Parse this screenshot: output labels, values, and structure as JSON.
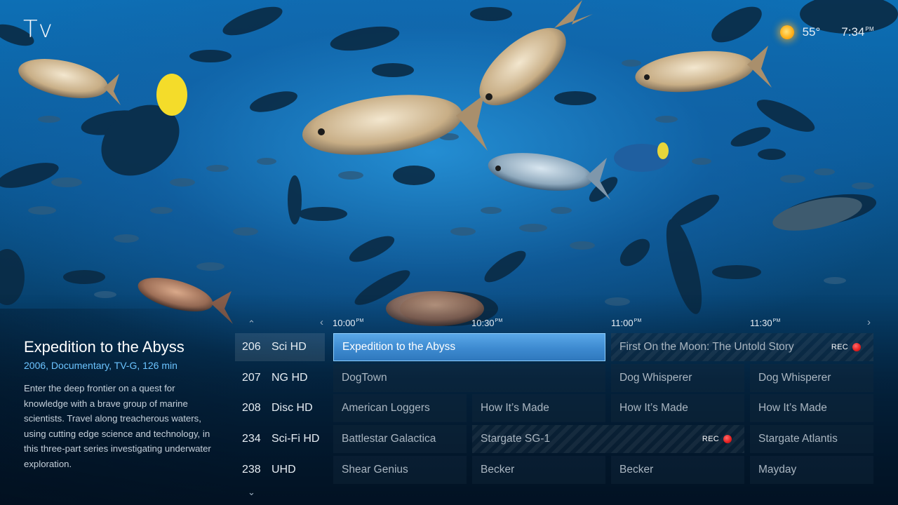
{
  "app": {
    "title": "Tv"
  },
  "status": {
    "weather_icon": "sun-icon",
    "temperature": "55°",
    "time": "7:34",
    "time_period": "PM"
  },
  "program": {
    "title": "Expedition to the Abyss",
    "meta": "2006, Documentary, TV-G, 126 min",
    "description": "Enter the deep frontier on a quest for knowledge with a brave group of marine scientists. Travel along treacherous waters, using cutting edge science and technology, in this three-part series investigating underwater exploration."
  },
  "guide": {
    "timeslots": [
      {
        "time": "10:00",
        "period": "PM"
      },
      {
        "time": "10:30",
        "period": "PM"
      },
      {
        "time": "11:00",
        "period": "PM"
      },
      {
        "time": "11:30",
        "period": "PM"
      }
    ],
    "rows": [
      {
        "number": "206",
        "name": "Sci HD",
        "programs": [
          {
            "title": "Expedition to the Abyss",
            "focused": true
          },
          {
            "title": "First On the Moon: The Untold Story",
            "rec": "REC"
          }
        ]
      },
      {
        "number": "207",
        "name": "NG HD",
        "programs": [
          {
            "title": "DogTown"
          },
          {
            "title": "Dog Whisperer"
          },
          {
            "title": "Dog Whisperer"
          }
        ]
      },
      {
        "number": "208",
        "name": "Disc HD",
        "programs": [
          {
            "title": "American Loggers"
          },
          {
            "title": "How It’s Made"
          },
          {
            "title": "How It’s Made"
          },
          {
            "title": "How It’s Made"
          }
        ]
      },
      {
        "number": "234",
        "name": "Sci-Fi HD",
        "programs": [
          {
            "title": "Battlestar Galactica"
          },
          {
            "title": "Stargate SG-1",
            "rec": "REC"
          },
          {
            "title": "Stargate Atlantis"
          }
        ]
      },
      {
        "number": "238",
        "name": "UHD",
        "programs": [
          {
            "title": "Shear Genius"
          },
          {
            "title": "Becker"
          },
          {
            "title": "Becker"
          },
          {
            "title": "Mayday"
          }
        ]
      }
    ]
  },
  "colors": {
    "accent": "#3d8ad0",
    "meta_text": "#6cc4ff",
    "rec_dot": "#e41f1f",
    "sun": "#ffb21c"
  }
}
